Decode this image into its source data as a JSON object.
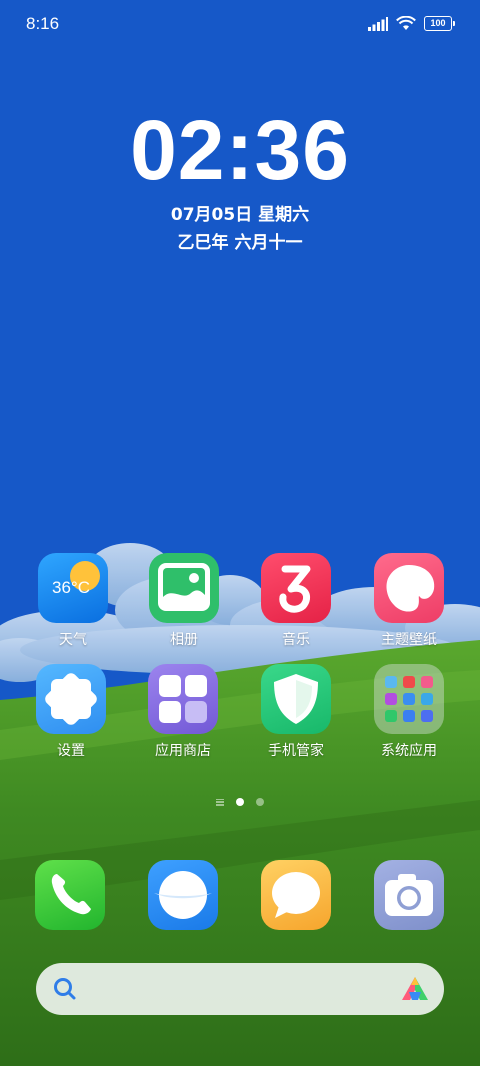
{
  "status_bar": {
    "time": "8:16",
    "battery": "100",
    "icons": [
      "signal-icon",
      "wifi-icon",
      "battery-icon"
    ]
  },
  "lock_clock": {
    "time": "02:36",
    "date": "07月05日 星期六",
    "lunar": "乙巳年 六月十一"
  },
  "apps": [
    {
      "label": "天气",
      "icon": "weather-icon",
      "temp": "36°C"
    },
    {
      "label": "相册",
      "icon": "gallery-icon"
    },
    {
      "label": "音乐",
      "icon": "music-icon"
    },
    {
      "label": "主题壁纸",
      "icon": "themes-icon"
    },
    {
      "label": "设置",
      "icon": "settings-icon"
    },
    {
      "label": "应用商店",
      "icon": "app-store-icon"
    },
    {
      "label": "手机管家",
      "icon": "security-icon"
    },
    {
      "label": "系统应用",
      "icon": "system-apps-folder-icon"
    }
  ],
  "dock": [
    {
      "icon": "phone-icon"
    },
    {
      "icon": "browser-icon"
    },
    {
      "icon": "messages-icon"
    },
    {
      "icon": "camera-icon"
    }
  ],
  "page_indicator": {
    "pages": 2,
    "current": 1
  },
  "search": {
    "icon": "search-icon",
    "assistant_icon": "ai-assistant-icon"
  },
  "colors": {
    "sky": "#1658c8",
    "grass": "#3f8a22",
    "weather_bg": "#1b8cf0",
    "gallery_bg": "#2fbf6a",
    "music_bg": "#f0335a",
    "themes_bg": "#f34d74",
    "settings_bg": "#46a9f5",
    "store_bg": "#8b72e0",
    "security_bg": "#23c77a",
    "phone_bg": "#3fd14a",
    "browser_bg": "#2a8df2",
    "messages_bg": "#f8b740",
    "camera_bg": "#8f9fd4"
  }
}
